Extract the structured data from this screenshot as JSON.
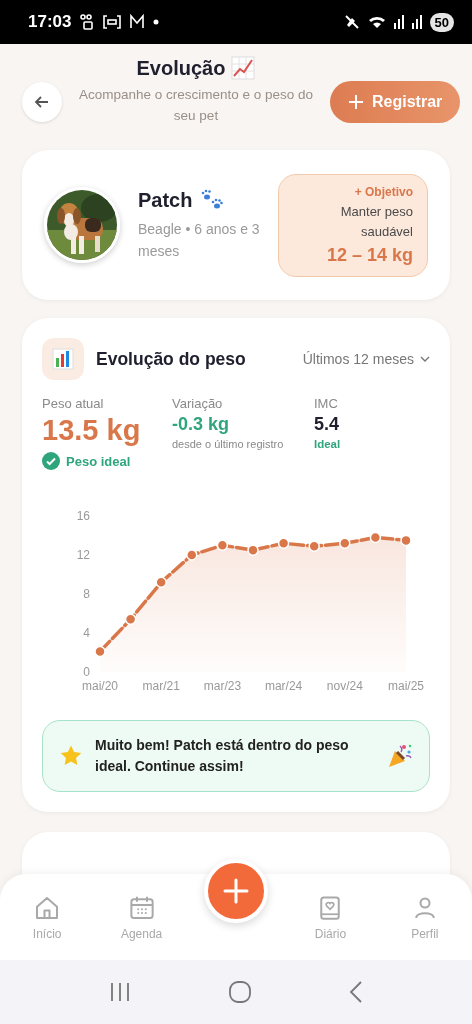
{
  "status_bar": {
    "time": "17:03",
    "battery": "50"
  },
  "header": {
    "title": "Evolução",
    "subtitle": "Acompanhe o crescimento e o peso do seu pet",
    "action": "Registrar"
  },
  "pet": {
    "name": "Patch",
    "details": "Beagle • 6 anos e 3 meses",
    "goal": {
      "label": "+ Objetivo",
      "description": "Manter peso saudável",
      "range": "12 – 14 kg"
    }
  },
  "weight_card": {
    "title": "Evolução do peso",
    "period": "Últimos 12 meses",
    "stats": [
      {
        "kind": "main",
        "label": "Peso atual",
        "value": "13.5 kg",
        "note": "Peso ideal"
      },
      {
        "kind": "change",
        "label": "Variação",
        "value": "-0.3 kg",
        "note": "desde o último registro"
      },
      {
        "kind": "index",
        "label": "IMC",
        "value": "5.4",
        "note": "Ideal"
      }
    ],
    "chart_data": {
      "type": "area",
      "categories": [
        "mai/20",
        null,
        "mar/21",
        null,
        "mar/23",
        null,
        "mar/24",
        null,
        "nov/24",
        null,
        "mai/25"
      ],
      "series": [
        {
          "color": "#d9774a",
          "values": [
            2.1,
            5.4,
            9.2,
            12.0,
            13.0,
            12.5,
            13.2,
            12.9,
            13.2,
            13.8,
            13.5
          ]
        }
      ],
      "ylim": [
        0,
        16
      ],
      "yticks": [
        0,
        4,
        8,
        12,
        16
      ]
    },
    "message": "Muito bem! Patch está dentro do peso ideal. Continue assim!"
  },
  "bottom_nav": {
    "items": [
      {
        "label": "Início",
        "selected": false
      },
      {
        "label": "Agenda",
        "selected": false
      },
      {
        "label": "Diário",
        "selected": false
      },
      {
        "label": "Perfil",
        "selected": false
      }
    ]
  }
}
